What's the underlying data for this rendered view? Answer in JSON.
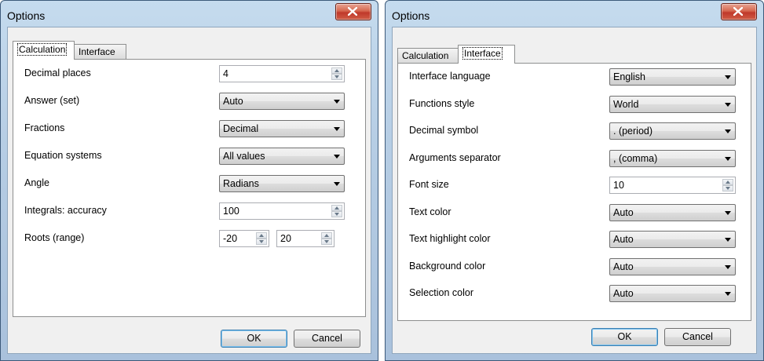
{
  "left": {
    "title": "Options",
    "tabs": [
      "Calculation",
      "Interface"
    ],
    "active_tab": "Calculation",
    "rows": [
      {
        "label": "Decimal places",
        "value": "4",
        "kind": "spin"
      },
      {
        "label": "Answer (set)",
        "value": "Auto",
        "kind": "combo"
      },
      {
        "label": "Fractions",
        "value": "Decimal",
        "kind": "combo"
      },
      {
        "label": "Equation systems",
        "value": "All values",
        "kind": "combo"
      },
      {
        "label": "Angle",
        "value": "Radians",
        "kind": "combo"
      },
      {
        "label": "Integrals: accuracy",
        "value": "100",
        "kind": "spin"
      },
      {
        "label": "Roots (range)",
        "value": "-20",
        "value2": "20",
        "kind": "spin2"
      }
    ],
    "ok": "OK",
    "cancel": "Cancel"
  },
  "right": {
    "title": "Options",
    "tabs": [
      "Calculation",
      "Interface"
    ],
    "active_tab": "Interface",
    "rows": [
      {
        "label": "Interface language",
        "value": "English",
        "kind": "combo"
      },
      {
        "label": "Functions style",
        "value": "World",
        "kind": "combo"
      },
      {
        "label": "Decimal symbol",
        "value": ". (period)",
        "kind": "combo"
      },
      {
        "label": "Arguments separator",
        "value": ", (comma)",
        "kind": "combo"
      },
      {
        "label": "Font size",
        "value": "10",
        "kind": "spin"
      },
      {
        "label": "Text color",
        "value": "Auto",
        "kind": "combo"
      },
      {
        "label": "Text highlight color",
        "value": "Auto",
        "kind": "combo"
      },
      {
        "label": "Background color",
        "value": "Auto",
        "kind": "combo"
      },
      {
        "label": "Selection color",
        "value": "Auto",
        "kind": "combo"
      }
    ],
    "ok": "OK",
    "cancel": "Cancel"
  },
  "icons": {
    "close": "close-icon",
    "spin_up": "spin-up-icon",
    "spin_down": "spin-down-icon",
    "dropdown": "chevron-down-icon"
  },
  "colors": {
    "close_button": "#c0392b",
    "frame": "#b6cde4",
    "default_button_border": "#3c7fb1"
  }
}
